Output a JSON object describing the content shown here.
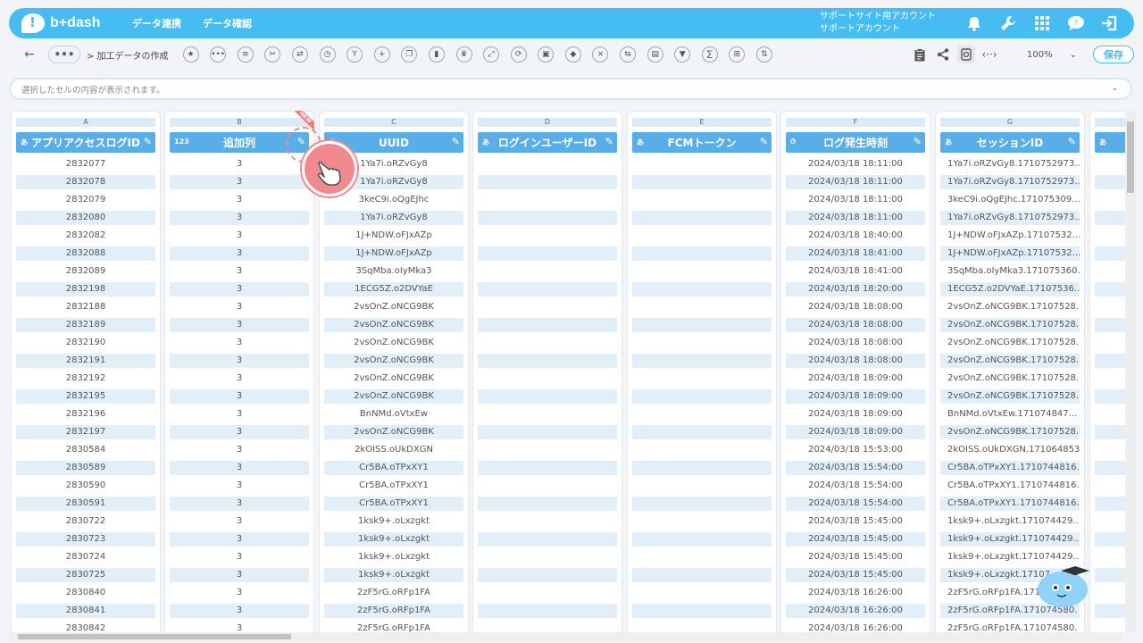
{
  "app": {
    "logo_text": "b+dash",
    "brand_color": "#45bdf2"
  },
  "nav": {
    "items": [
      "データ連携",
      "データ確認"
    ]
  },
  "account": {
    "line1": "サポートサイト用アカウント",
    "line2": "サポートアカウント"
  },
  "top_icons": [
    "bell-icon",
    "wrench-icon",
    "grid-icon",
    "chat-icon",
    "logout-icon"
  ],
  "toolbar": {
    "back_icon": "←",
    "more_label": "•••",
    "breadcrumb": "> 加工データの作成",
    "tool_icons": [
      "star-icon",
      "more-icon",
      "list-icon",
      "scissors-icon",
      "merge-icon",
      "timer-icon",
      "branch-icon",
      "plus-icon",
      "copy-icon",
      "trash-icon",
      "crown-icon",
      "expand-icon",
      "refresh-icon",
      "lock-icon",
      "box-icon",
      "close-circle-icon",
      "replace-icon",
      "file-icon",
      "filter-icon",
      "formula-icon",
      "table-icon",
      "transfer-icon"
    ],
    "zoom": "100%",
    "save_label": "保存"
  },
  "cellbar": {
    "placeholder": "選択したセルの内容が表示されます。"
  },
  "columns": [
    {
      "letter": "A",
      "type": "あ",
      "name": "アプリアクセスログID"
    },
    {
      "letter": "B",
      "type": "123",
      "name": "追加列",
      "badge": "NEW"
    },
    {
      "letter": "C",
      "type": "あ",
      "name": "UUID"
    },
    {
      "letter": "D",
      "type": "あ",
      "name": "ログインユーザーID"
    },
    {
      "letter": "E",
      "type": "あ",
      "name": "FCMトークン"
    },
    {
      "letter": "F",
      "type": "⏱",
      "name": "ログ発生時刻"
    },
    {
      "letter": "G",
      "type": "あ",
      "name": "セッションID"
    },
    {
      "letter": "",
      "type": "あ",
      "name": ""
    }
  ],
  "rows": [
    [
      "2832077",
      "3",
      "1Ya7i.oRZvGy8",
      "",
      "",
      "2024/03/18 18:11:00",
      "1Ya7i.oRZvGy8.1710752973..."
    ],
    [
      "2832078",
      "3",
      "1Ya7i.oRZvGy8",
      "",
      "",
      "2024/03/18 18:11:00",
      "1Ya7i.oRZvGy8.1710752973..."
    ],
    [
      "2832079",
      "3",
      "3keC9i.oQgEJhc",
      "",
      "",
      "2024/03/18 18:11:00",
      "3keC9i.oQgEJhc.171075309..."
    ],
    [
      "2832080",
      "3",
      "1Ya7i.oRZvGy8",
      "",
      "",
      "2024/03/18 18:11:00",
      "1Ya7i.oRZvGy8.1710752973..."
    ],
    [
      "2832082",
      "3",
      "1J+NDW.oFJxAZp",
      "",
      "",
      "2024/03/18 18:40:00",
      "1J+NDW.oFJxAZp.17107532..."
    ],
    [
      "2832088",
      "3",
      "1J+NDW.oFJxAZp",
      "",
      "",
      "2024/03/18 18:41:00",
      "1J+NDW.oFJxAZp.17107532..."
    ],
    [
      "2832089",
      "3",
      "3SqMba.oIyMka3",
      "",
      "",
      "2024/03/18 18:41:00",
      "3SqMba.oIyMka3.171075360..."
    ],
    [
      "2832198",
      "3",
      "1ECG5Z.o2DVYaE",
      "",
      "",
      "2024/03/18 18:20:00",
      "1ECG5Z.o2DVYaE.17107536..."
    ],
    [
      "2832188",
      "3",
      "2vsOnZ.oNCG9BK",
      "",
      "",
      "2024/03/18 18:08:00",
      "2vsOnZ.oNCG9BK.17107528..."
    ],
    [
      "2832189",
      "3",
      "2vsOnZ.oNCG9BK",
      "",
      "",
      "2024/03/18 18:08:00",
      "2vsOnZ.oNCG9BK.17107528..."
    ],
    [
      "2832190",
      "3",
      "2vsOnZ.oNCG9BK",
      "",
      "",
      "2024/03/18 18:08:00",
      "2vsOnZ.oNCG9BK.17107528..."
    ],
    [
      "2832191",
      "3",
      "2vsOnZ.oNCG9BK",
      "",
      "",
      "2024/03/18 18:08:00",
      "2vsOnZ.oNCG9BK.17107528..."
    ],
    [
      "2832192",
      "3",
      "2vsOnZ.oNCG9BK",
      "",
      "",
      "2024/03/18 18:09:00",
      "2vsOnZ.oNCG9BK.17107528..."
    ],
    [
      "2832195",
      "3",
      "2vsOnZ.oNCG9BK",
      "",
      "",
      "2024/03/18 18:09:00",
      "2vsOnZ.oNCG9BK.17107528..."
    ],
    [
      "2832196",
      "3",
      "BnNMd.oVtxEw",
      "",
      "",
      "2024/03/18 18:09:00",
      "BnNMd.oVtxEw.171074847..."
    ],
    [
      "2832197",
      "3",
      "2vsOnZ.oNCG9BK",
      "",
      "",
      "2024/03/18 18:09:00",
      "2vsOnZ.oNCG9BK.17107528..."
    ],
    [
      "2830584",
      "3",
      "2kOISS.oUkDXGN",
      "",
      "",
      "2024/03/18 15:53:00",
      "2kOISS.oUkDXGN.171064853..."
    ],
    [
      "2830589",
      "3",
      "Cr5BA.oTPxXY1",
      "",
      "",
      "2024/03/18 15:54:00",
      "Cr5BA.oTPxXY1.1710744816..."
    ],
    [
      "2830590",
      "3",
      "Cr5BA.oTPxXY1",
      "",
      "",
      "2024/03/18 15:54:00",
      "Cr5BA.oTPxXY1.1710744816..."
    ],
    [
      "2830591",
      "3",
      "Cr5BA.oTPxXY1",
      "",
      "",
      "2024/03/18 15:54:00",
      "Cr5BA.oTPxXY1.1710744816..."
    ],
    [
      "2830722",
      "3",
      "1ksk9+.oLxzgkt",
      "",
      "",
      "2024/03/18 15:45:00",
      "1ksk9+.oLxzgkt.171074429..."
    ],
    [
      "2830723",
      "3",
      "1ksk9+.oLxzgkt",
      "",
      "",
      "2024/03/18 15:45:00",
      "1ksk9+.oLxzgkt.171074429..."
    ],
    [
      "2830724",
      "3",
      "1ksk9+.oLxzgkt",
      "",
      "",
      "2024/03/18 15:45:00",
      "1ksk9+.oLxzgkt.171074429..."
    ],
    [
      "2830725",
      "3",
      "1ksk9+.oLxzgkt",
      "",
      "",
      "2024/03/18 15:45:00",
      "1ksk9+.oLxzgkt.17107"
    ],
    [
      "2830840",
      "3",
      "2zF5rG.oRFp1FA",
      "",
      "",
      "2024/03/18 16:26:00",
      "2zF5rG.oRFp1FA.1710"
    ],
    [
      "2830841",
      "3",
      "2zF5rG.oRFp1FA",
      "",
      "",
      "2024/03/18 16:26:00",
      "2zF5rG.oRFp1FA.171074580."
    ],
    [
      "2830842",
      "3",
      "2zF5rG.oRFp1FA",
      "",
      "",
      "2024/03/18 16:26:00",
      "2zF5rG.oRFp1FA.171074580."
    ]
  ],
  "overlay": {
    "pointer_icon": "hand-pointer-icon",
    "mascot": "mascot-icon",
    "pointer_color": "#f08a8e"
  }
}
